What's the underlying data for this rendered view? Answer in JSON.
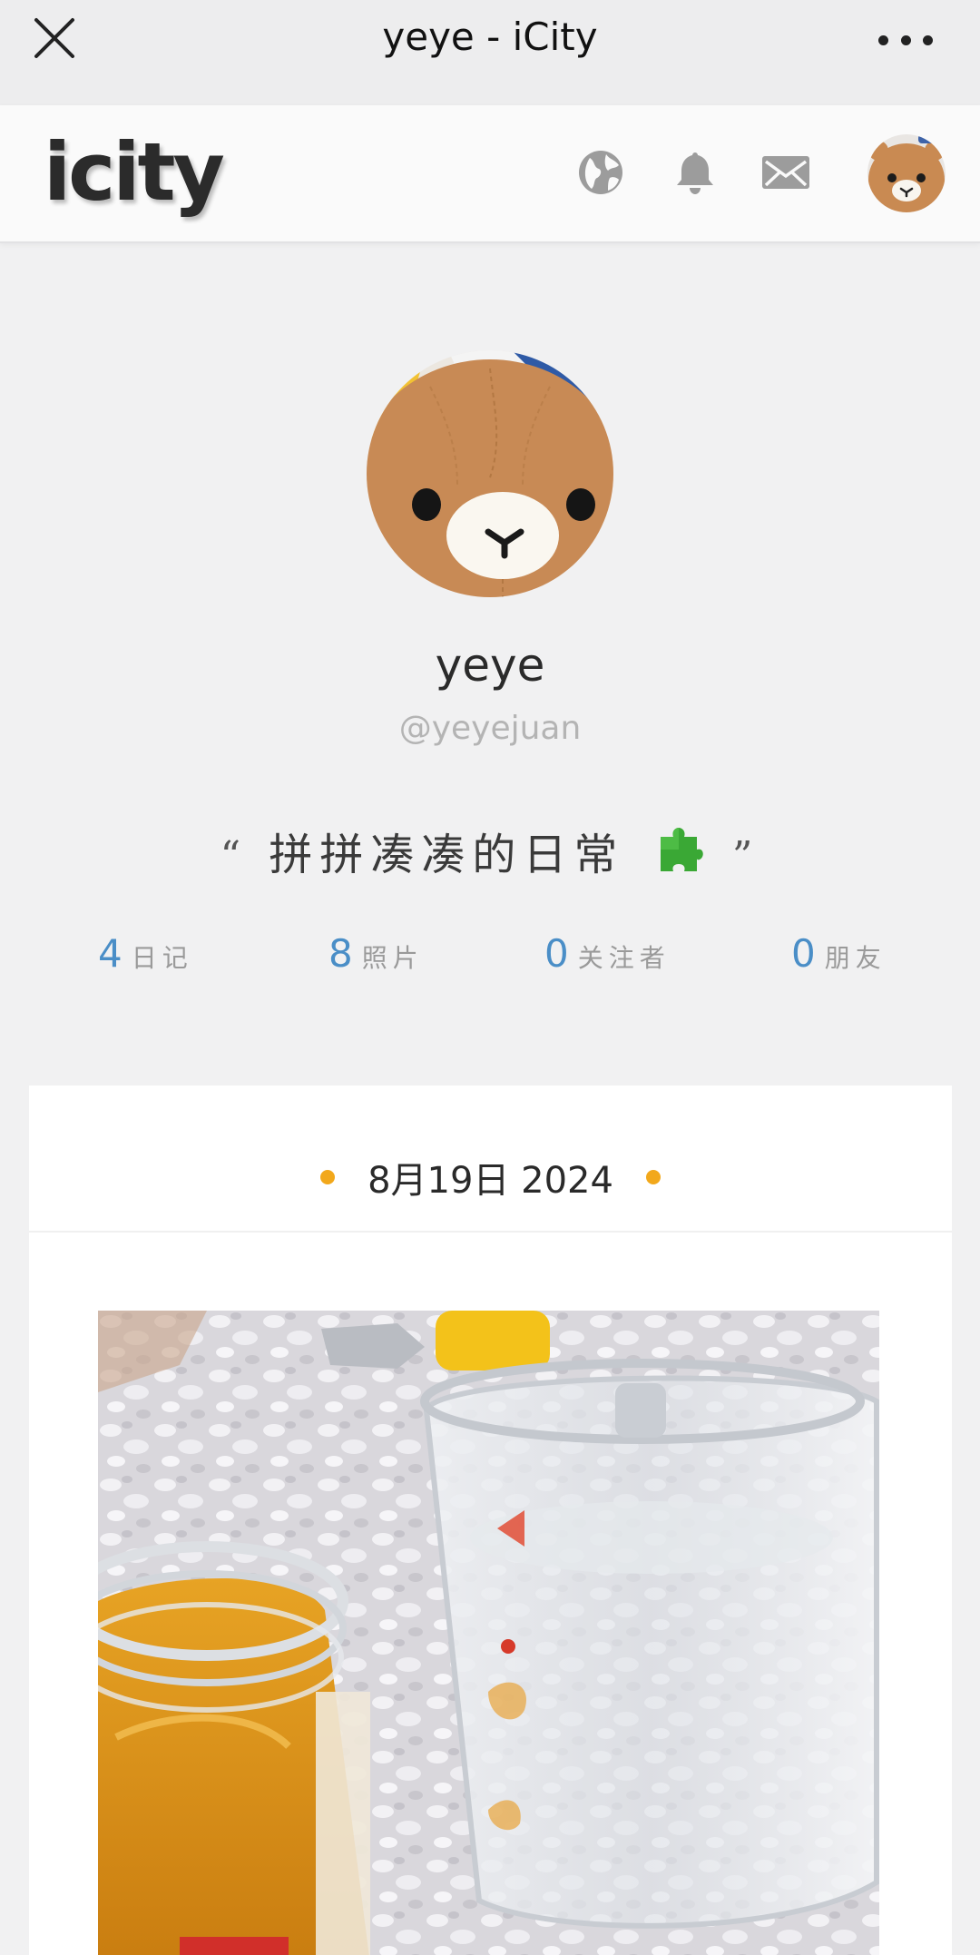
{
  "topbar": {
    "title": "yeye - iCity"
  },
  "appbar": {
    "logo": "icity"
  },
  "profile": {
    "username": "yeye",
    "handle": "@yeyejuan",
    "bio_open_quote": "“",
    "bio": "拼拼凑凑的日常",
    "bio_close_quote": "”"
  },
  "stats": [
    {
      "value": "4",
      "label": "日记"
    },
    {
      "value": "8",
      "label": "照片"
    },
    {
      "value": "0",
      "label": "关注者"
    },
    {
      "value": "0",
      "label": "朋友"
    }
  ],
  "entry": {
    "date": "8月19日 2024"
  },
  "colors": {
    "accent_blue": "#4a8ec7",
    "date_dot": "#f2a81b",
    "background": "#f1f1f2"
  }
}
